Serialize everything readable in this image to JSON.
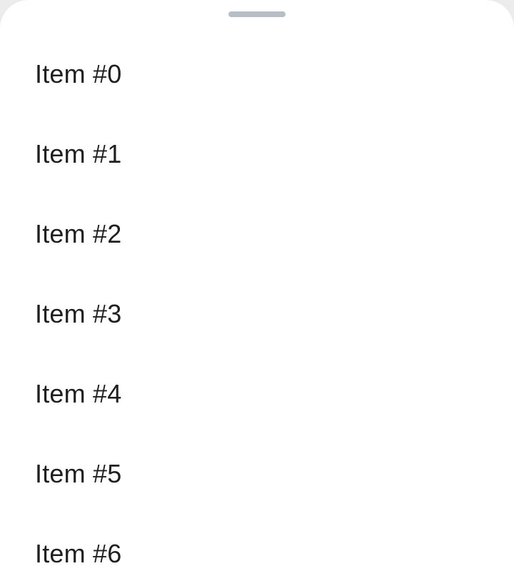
{
  "sheet": {
    "handle_icon": "drag-handle",
    "items": [
      {
        "label": "Item #0"
      },
      {
        "label": "Item #1"
      },
      {
        "label": "Item #2"
      },
      {
        "label": "Item #3"
      },
      {
        "label": "Item #4"
      },
      {
        "label": "Item #5"
      },
      {
        "label": "Item #6"
      }
    ]
  },
  "colors": {
    "background": "#ffffff",
    "handle": "#b7bec6",
    "text": "#1f1f1f"
  }
}
